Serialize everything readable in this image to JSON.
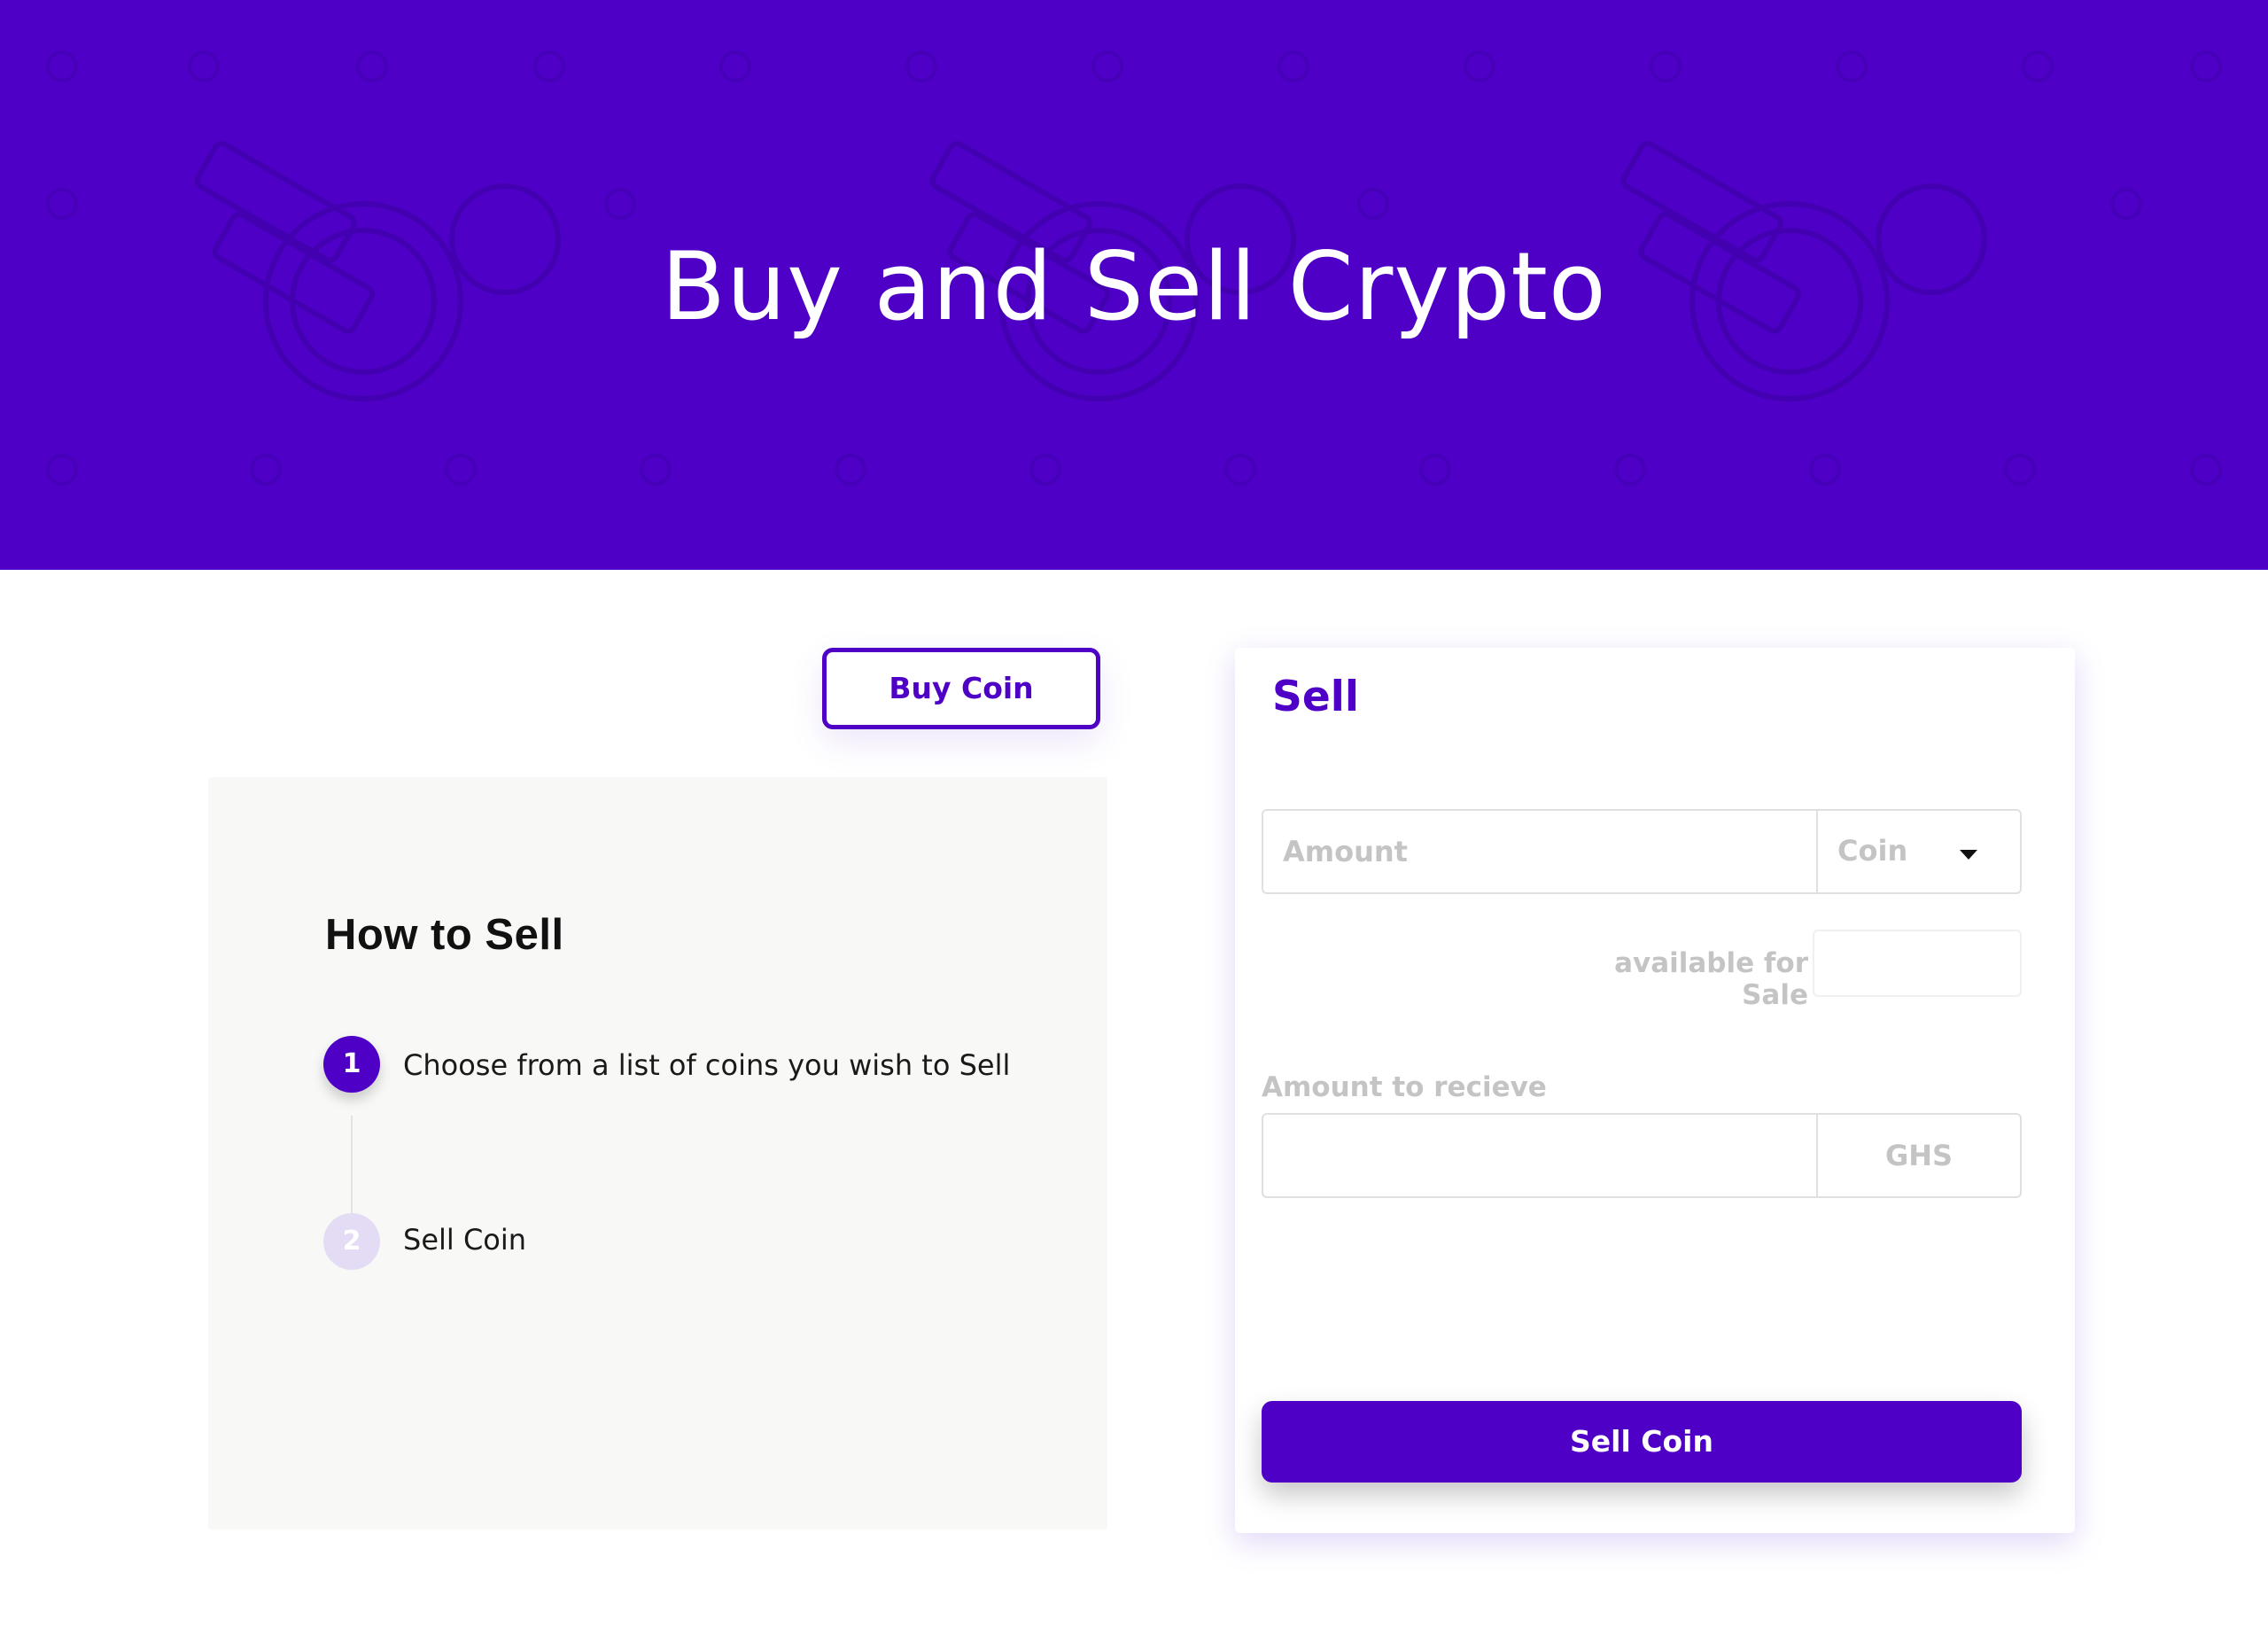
{
  "hero": {
    "title": "Buy and Sell Crypto",
    "background_color": "#4e00c6"
  },
  "toolbar": {
    "buy_label": "Buy Coin"
  },
  "how_to": {
    "title": "How to Sell",
    "steps": [
      {
        "number": "1",
        "text": "Choose from a list of coins you wish to Sell",
        "state": "active"
      },
      {
        "number": "2",
        "text": "Sell Coin",
        "state": "inactive"
      }
    ]
  },
  "sell_form": {
    "title": "Sell",
    "amount_placeholder": "Amount",
    "coin_select_value": "Coin",
    "available_label": "available for Sale",
    "receive_label": "Amount to recieve",
    "currency": "GHS",
    "submit_label": "Sell Coin"
  },
  "colors": {
    "accent": "#4e00c6",
    "step_inactive": "#e4dcf4",
    "panel_bg": "#f8f8f7",
    "placeholder": "#c4c4c4"
  },
  "icons": [
    "chevron-down-icon"
  ]
}
